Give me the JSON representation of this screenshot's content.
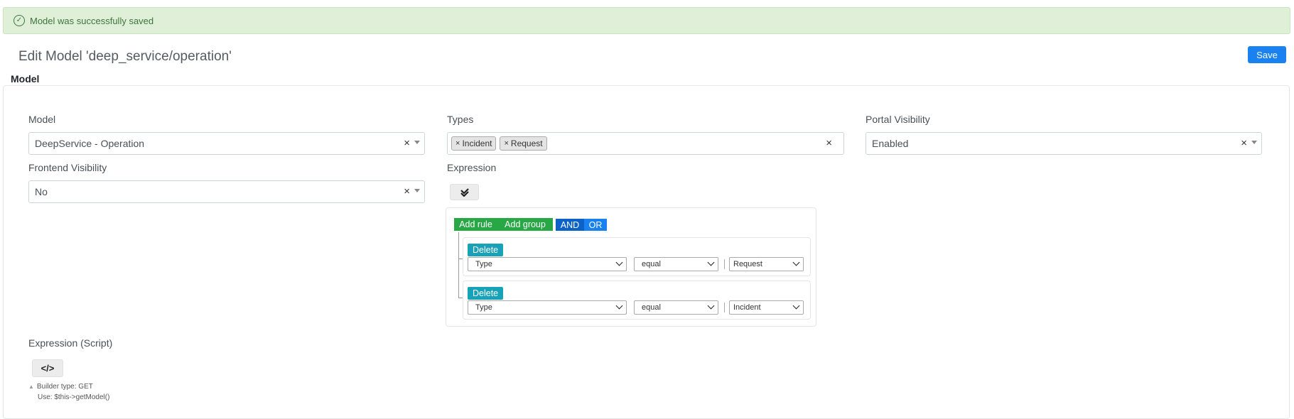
{
  "alert": {
    "message": "Model was successfully saved",
    "icon": "check-circle-icon",
    "color": "#3c763d"
  },
  "header": {
    "title": "Edit Model 'deep_service/operation'",
    "save_label": "Save"
  },
  "section": {
    "label": "Model"
  },
  "fields": {
    "model": {
      "label": "Model",
      "value": "DeepService - Operation",
      "clear": "×"
    },
    "types": {
      "label": "Types",
      "tags": [
        "Incident",
        "Request"
      ],
      "tag_remove": "×",
      "clear": "×"
    },
    "portal_visibility": {
      "label": "Portal Visibility",
      "value": "Enabled",
      "clear": "×"
    },
    "frontend_visibility": {
      "label": "Frontend Visibility",
      "value": "No",
      "clear": "×"
    },
    "expression": {
      "label": "Expression",
      "toggle_icon": "double-check-icon"
    },
    "expression_script": {
      "label": "Expression (Script)",
      "toggle_icon": "code-icon"
    }
  },
  "query_builder": {
    "add_rule": "Add rule",
    "add_group": "Add group",
    "and": "AND",
    "or": "OR",
    "rules": [
      {
        "delete": "Delete",
        "field": "Type",
        "operator": "equal",
        "value": "Request"
      },
      {
        "delete": "Delete",
        "field": "Type",
        "operator": "equal",
        "value": "Incident"
      }
    ]
  },
  "help": {
    "builder_type": "Builder type: GET",
    "usage": "Use: $this->getModel()"
  },
  "colors": {
    "primary": "#1a82f0",
    "success": "#28a745",
    "info": "#17a2b8",
    "alert_bg": "#dfefd8"
  }
}
